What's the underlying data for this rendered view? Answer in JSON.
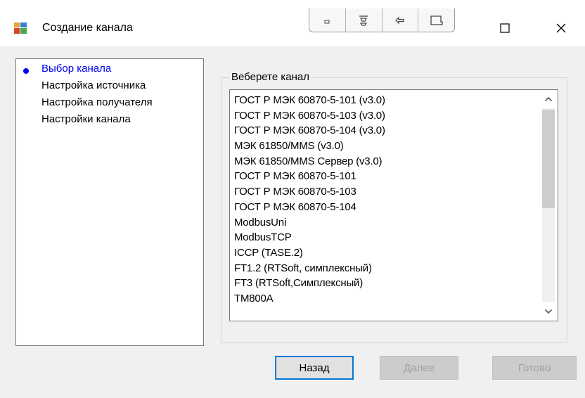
{
  "window": {
    "title": "Создание канала",
    "icon": "wizard-app-icon"
  },
  "steps": [
    {
      "label": "Выбор канала",
      "active": true
    },
    {
      "label": "Настройка источника",
      "active": false
    },
    {
      "label": "Настройка получателя",
      "active": false
    },
    {
      "label": "Настройки канала",
      "active": false
    }
  ],
  "channel_group": {
    "label": "Веберете канал",
    "items": [
      "ГОСТ Р МЭК 60870-5-101 (v3.0)",
      "ГОСТ Р МЭК 60870-5-103 (v3.0)",
      "ГОСТ Р МЭК 60870-5-104 (v3.0)",
      "МЭК 61850/MMS (v3.0)",
      "МЭК 61850/MMS Сервер (v3.0)",
      "ГОСТ Р МЭК 60870-5-101",
      "ГОСТ Р МЭК 60870-5-103",
      "ГОСТ Р МЭК 60870-5-104",
      "ModbusUni",
      "ModbusTCP",
      "ICCP (TASE.2)",
      "FT1.2 (RTSoft, симплексный)",
      "FT3 (RTSoft,Симплексный)",
      "TM800A"
    ]
  },
  "buttons": {
    "back": "Назад",
    "next": "Далее",
    "finish": "Готово"
  },
  "colors": {
    "active_step": "#0000ee",
    "dialog_bg": "#f0f0f0",
    "focus_border": "#0078d7",
    "disabled_text": "#a0a0a0"
  }
}
